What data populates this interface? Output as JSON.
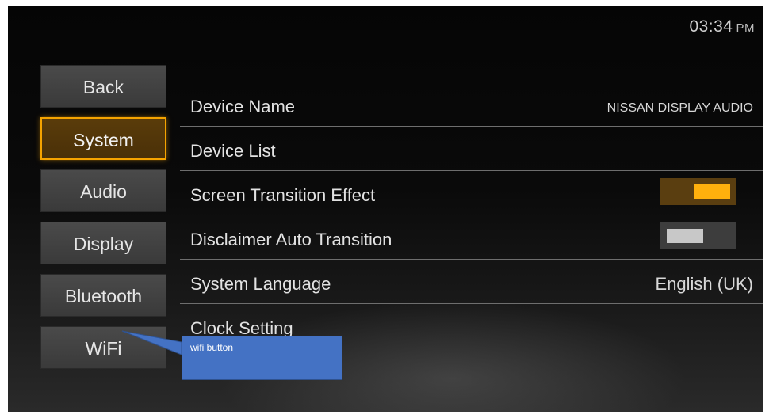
{
  "status_bar": {
    "time": "03:34",
    "ampm": "PM"
  },
  "nav": {
    "back": "Back",
    "system": "System",
    "audio": "Audio",
    "display": "Display",
    "bluetooth": "Bluetooth",
    "wifi": "WiFi",
    "active": "System"
  },
  "settings": {
    "device_name": {
      "label": "Device Name",
      "value": "NISSAN DISPLAY AUDIO"
    },
    "device_list": {
      "label": "Device List"
    },
    "screen_transition": {
      "label": "Screen Transition Effect",
      "state": "on"
    },
    "disclaimer": {
      "label": "Disclaimer Auto Transition",
      "state": "off"
    },
    "language": {
      "label": "System Language",
      "value": "English (UK)"
    },
    "clock": {
      "label": "Clock Setting"
    }
  },
  "annotation": {
    "text": "wifi button"
  },
  "colors": {
    "accent": "#f5a300",
    "toggle_on_knob": "#ffb00d",
    "callout": "#4472c4"
  }
}
